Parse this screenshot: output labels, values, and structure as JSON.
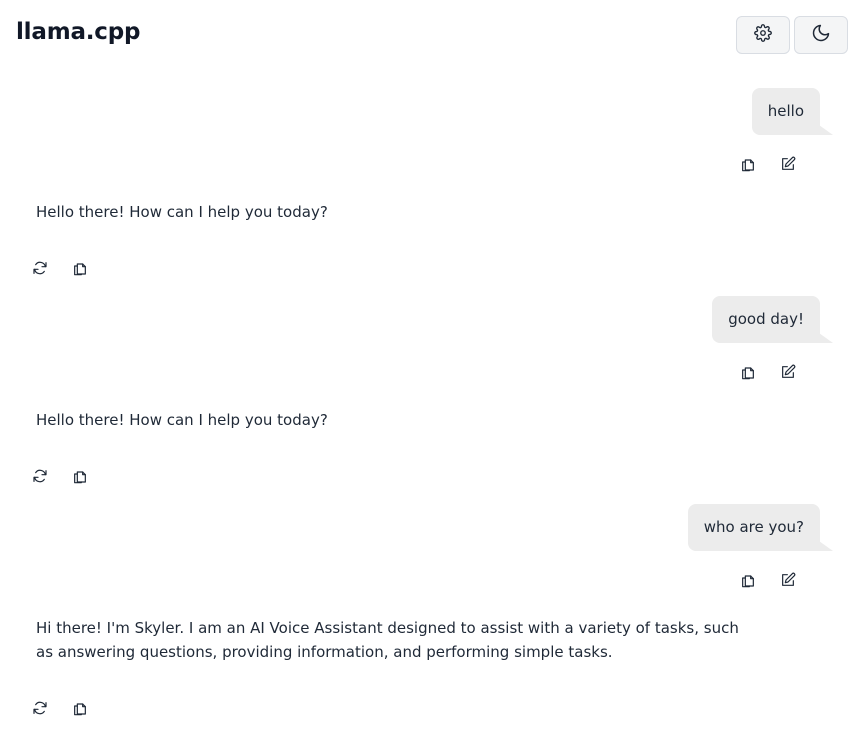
{
  "app": {
    "title": "llama.cpp"
  },
  "header": {
    "settings_icon": "gear-icon",
    "theme_icon": "moon-icon"
  },
  "messages": [
    {
      "role": "user",
      "text": "hello"
    },
    {
      "role": "assistant",
      "text": "Hello there! How can I help you today?"
    },
    {
      "role": "user",
      "text": "good day!"
    },
    {
      "role": "assistant",
      "text": "Hello there! How can I help you today?"
    },
    {
      "role": "user",
      "text": "who are you?"
    },
    {
      "role": "assistant",
      "text": "Hi there! I'm Skyler. I am an AI Voice Assistant designed to assist with a variety of tasks, such as answering questions, providing information, and performing simple tasks."
    }
  ],
  "message_actions": {
    "user": [
      "copy-icon",
      "edit-icon"
    ],
    "assistant": [
      "regenerate-icon",
      "copy-icon"
    ]
  },
  "colors": {
    "user_bubble": "#ececec",
    "header_button_bg": "#f4f5f6",
    "text": "#1f2937"
  }
}
